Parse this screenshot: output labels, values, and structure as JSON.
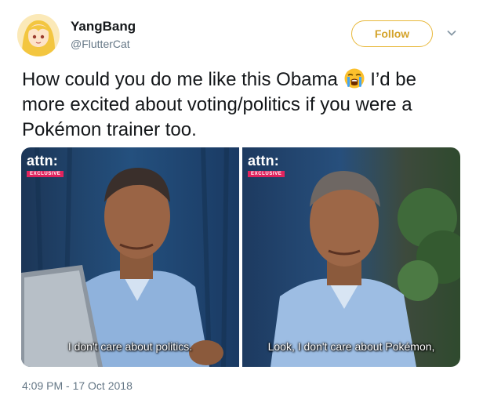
{
  "author": {
    "name": "YangBang",
    "handle": "@FlutterCat"
  },
  "actions": {
    "follow_label": "Follow"
  },
  "tweet": {
    "text_before_emoji": "How could you do me like this Obama ",
    "text_after_emoji": " I’d be more excited about voting/politics if you were a Pokémon trainer too.",
    "emoji_icon": "loudly-crying-face-icon",
    "timestamp": "4:09 PM - 17 Oct 2018"
  },
  "media": {
    "panels": [
      {
        "logo": "attn:",
        "badge": "EXCLUSIVE",
        "caption": "I don't care about politics."
      },
      {
        "logo": "attn:",
        "badge": "EXCLUSIVE",
        "caption": "Look, I don't care about Pokémon,"
      }
    ]
  },
  "colors": {
    "follow_accent": "#e8b83a",
    "secondary_text": "#657786",
    "badge": "#e0245e"
  }
}
